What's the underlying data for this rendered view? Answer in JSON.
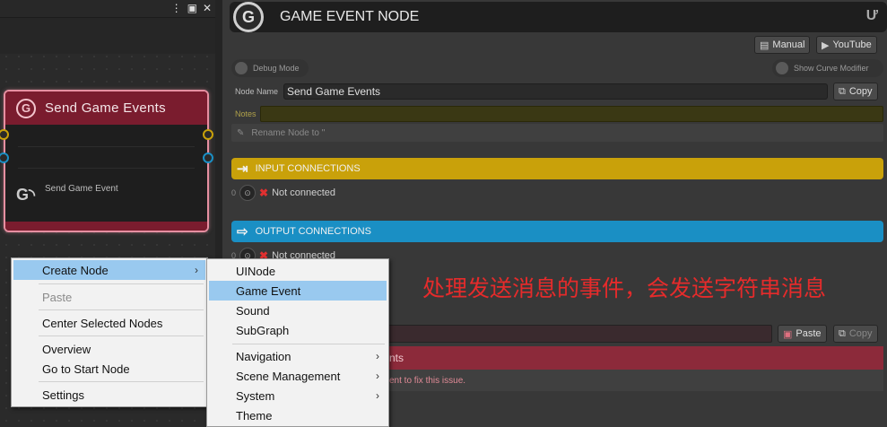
{
  "graph": {
    "node": {
      "title": "Send Game Events",
      "subtitle": "Send Game Event",
      "logo": "G"
    }
  },
  "inspector": {
    "header": {
      "logo": "G",
      "title": "GAME EVENT NODE"
    },
    "buttons": {
      "manual": "Manual",
      "youtube": "YouTube",
      "copy": "Copy",
      "paste": "Paste",
      "copy2": "Copy"
    },
    "toggles": {
      "debug_mode": "Debug Mode",
      "show_curve_modifier": "Show Curve Modifier"
    },
    "node_name_label": "Node Name",
    "node_name_value": "Send Game Events",
    "notes_label": "Notes",
    "rename_label": "Rename Node to \"",
    "input_section": "INPUT CONNECTIONS",
    "output_section": "OUTPUT CONNECTIONS",
    "input_count": "0",
    "output_count": "0",
    "not_connected": "Not connected",
    "error_header_fragment": "nts",
    "error_body_fragment": "ent to fix this issue."
  },
  "annotation": "处理发送消息的事件，会发送字符串消息",
  "context_menu": {
    "items": [
      {
        "label": "Create Node",
        "highlighted": true,
        "submenu": true
      },
      {
        "label": "Paste",
        "disabled": true
      },
      {
        "label": "Center Selected Nodes"
      },
      {
        "label": "Overview"
      },
      {
        "label": "Go to Start Node"
      },
      {
        "label": "Settings"
      }
    ]
  },
  "submenu": {
    "items": [
      {
        "label": "UINode"
      },
      {
        "label": "Game Event",
        "highlighted": true
      },
      {
        "label": "Sound"
      },
      {
        "label": "SubGraph"
      },
      {
        "label": "Navigation",
        "submenu": true
      },
      {
        "label": "Scene Management",
        "submenu": true
      },
      {
        "label": "System",
        "submenu": true
      },
      {
        "label": "Theme"
      }
    ]
  },
  "colors": {
    "node_header": "#7a1c2e",
    "node_border": "#e68fa1",
    "input_section": "#c9a10a",
    "output_section": "#1a8fc4",
    "menu_highlight": "#99c9ef",
    "annotation_text": "#e52b2b"
  }
}
